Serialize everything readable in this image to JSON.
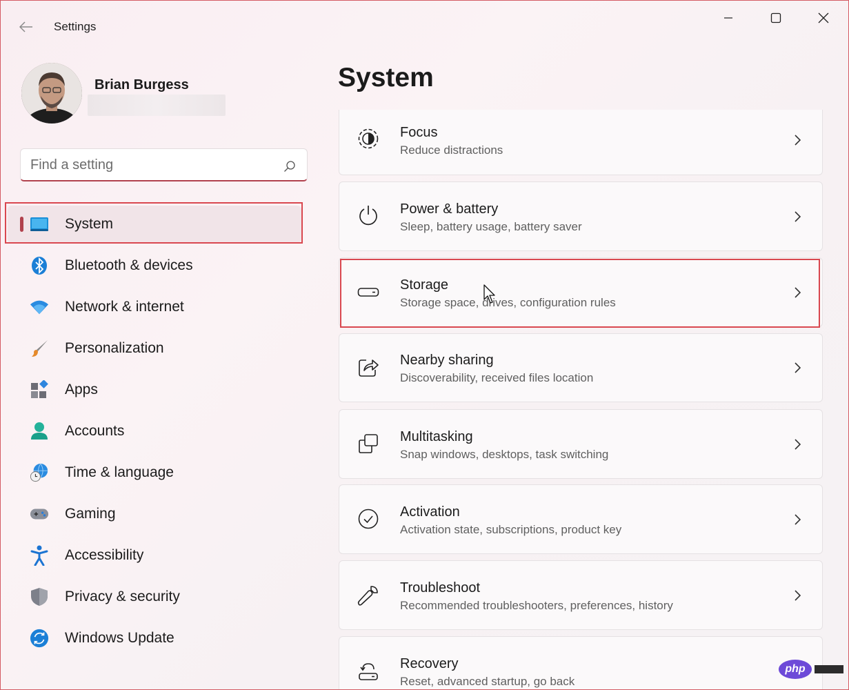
{
  "app": {
    "title": "Settings"
  },
  "profile": {
    "name": "Brian Burgess"
  },
  "search": {
    "placeholder": "Find a setting"
  },
  "nav": {
    "items": [
      {
        "label": "System",
        "icon": "system-icon",
        "active": true
      },
      {
        "label": "Bluetooth & devices",
        "icon": "bluetooth-icon"
      },
      {
        "label": "Network & internet",
        "icon": "wifi-icon"
      },
      {
        "label": "Personalization",
        "icon": "brush-icon"
      },
      {
        "label": "Apps",
        "icon": "apps-icon"
      },
      {
        "label": "Accounts",
        "icon": "accounts-icon"
      },
      {
        "label": "Time & language",
        "icon": "globe-clock-icon"
      },
      {
        "label": "Gaming",
        "icon": "gamepad-icon"
      },
      {
        "label": "Accessibility",
        "icon": "accessibility-icon"
      },
      {
        "label": "Privacy & security",
        "icon": "shield-icon"
      },
      {
        "label": "Windows Update",
        "icon": "update-icon"
      }
    ]
  },
  "main": {
    "title": "System",
    "cards": [
      {
        "title": "Focus",
        "subtitle": "Reduce distractions",
        "icon": "focus-icon"
      },
      {
        "title": "Power & battery",
        "subtitle": "Sleep, battery usage, battery saver",
        "icon": "power-icon"
      },
      {
        "title": "Storage",
        "subtitle": "Storage space, drives, configuration rules",
        "icon": "storage-icon",
        "highlighted": true
      },
      {
        "title": "Nearby sharing",
        "subtitle": "Discoverability, received files location",
        "icon": "share-icon"
      },
      {
        "title": "Multitasking",
        "subtitle": "Snap windows, desktops, task switching",
        "icon": "multitasking-icon"
      },
      {
        "title": "Activation",
        "subtitle": "Activation state, subscriptions, product key",
        "icon": "check-circle-icon"
      },
      {
        "title": "Troubleshoot",
        "subtitle": "Recommended troubleshooters, preferences, history",
        "icon": "wrench-icon"
      },
      {
        "title": "Recovery",
        "subtitle": "Reset, advanced startup, go back",
        "icon": "recovery-icon"
      }
    ]
  },
  "watermark": {
    "text": "php"
  },
  "colors": {
    "accent": "#b1414d",
    "highlight": "#d9474f",
    "background": "#f9eef2"
  }
}
